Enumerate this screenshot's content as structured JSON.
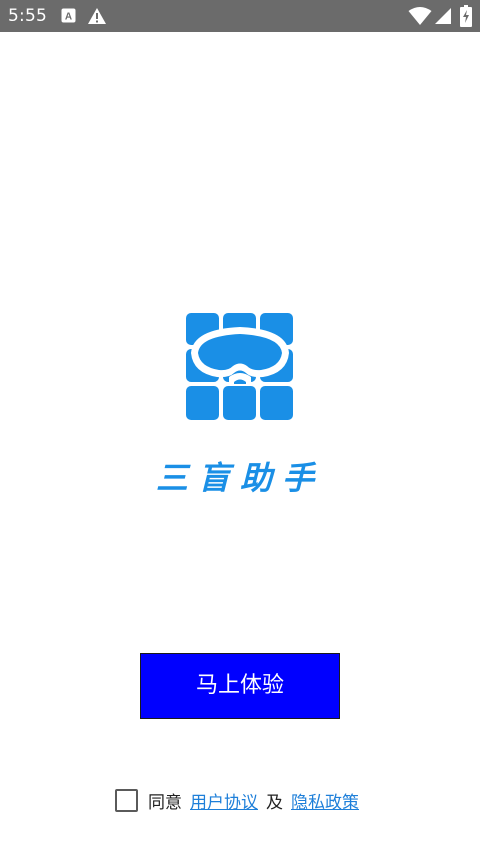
{
  "status_bar": {
    "time": "5:55",
    "icons": [
      "keyboard-a-icon",
      "warning-icon",
      "wifi-icon",
      "signal-icon",
      "battery-icon"
    ]
  },
  "app": {
    "logo_icon": "mask-grid-logo-icon",
    "title": "三盲助手",
    "accent_color": "#1a8fe6"
  },
  "main": {
    "start_button_label": "马上体验",
    "start_button_color": "#0000ff"
  },
  "agreement": {
    "checked": false,
    "agree_text": "同意",
    "user_agreement_link": "用户协议",
    "and_text": "及",
    "privacy_policy_link": "隐私政策"
  }
}
